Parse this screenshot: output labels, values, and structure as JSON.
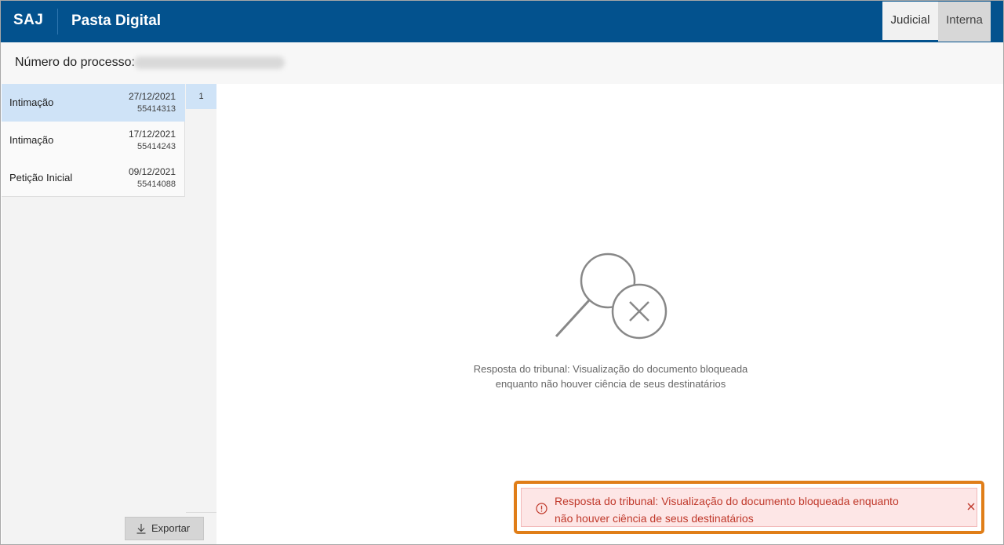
{
  "header": {
    "brand": "SAJ",
    "title": "Pasta Digital",
    "tabs": [
      {
        "label": "Judicial",
        "active": true
      },
      {
        "label": "Interna",
        "active": false
      }
    ]
  },
  "process": {
    "label": "Número do processo:"
  },
  "documents": [
    {
      "name": "Intimação",
      "date": "27/12/2021",
      "id": "55414313",
      "selected": true
    },
    {
      "name": "Intimação",
      "date": "17/12/2021",
      "id": "55414243",
      "selected": false
    },
    {
      "name": "Petição Inicial",
      "date": "09/12/2021",
      "id": "55414088",
      "selected": false
    }
  ],
  "pages": {
    "current": "1"
  },
  "export": {
    "label": "Exportar"
  },
  "viewer": {
    "message_line1": "Resposta do tribunal: Visualização do documento bloqueada",
    "message_line2": "enquanto não houver ciência de seus destinatários"
  },
  "toast": {
    "line1": "Resposta do tribunal: Visualização do documento bloqueada enquanto",
    "line2": "não houver ciência de seus destinatários"
  },
  "icons": {
    "empty": "search-blocked-icon",
    "export": "download-icon",
    "alert": "alert-circle-icon",
    "close": "close-icon"
  },
  "colors": {
    "header": "#03528e",
    "selected": "#cfe3f7",
    "toast_text": "#c0392b",
    "toast_bg": "#fde6e6",
    "highlight": "#e07e18"
  }
}
